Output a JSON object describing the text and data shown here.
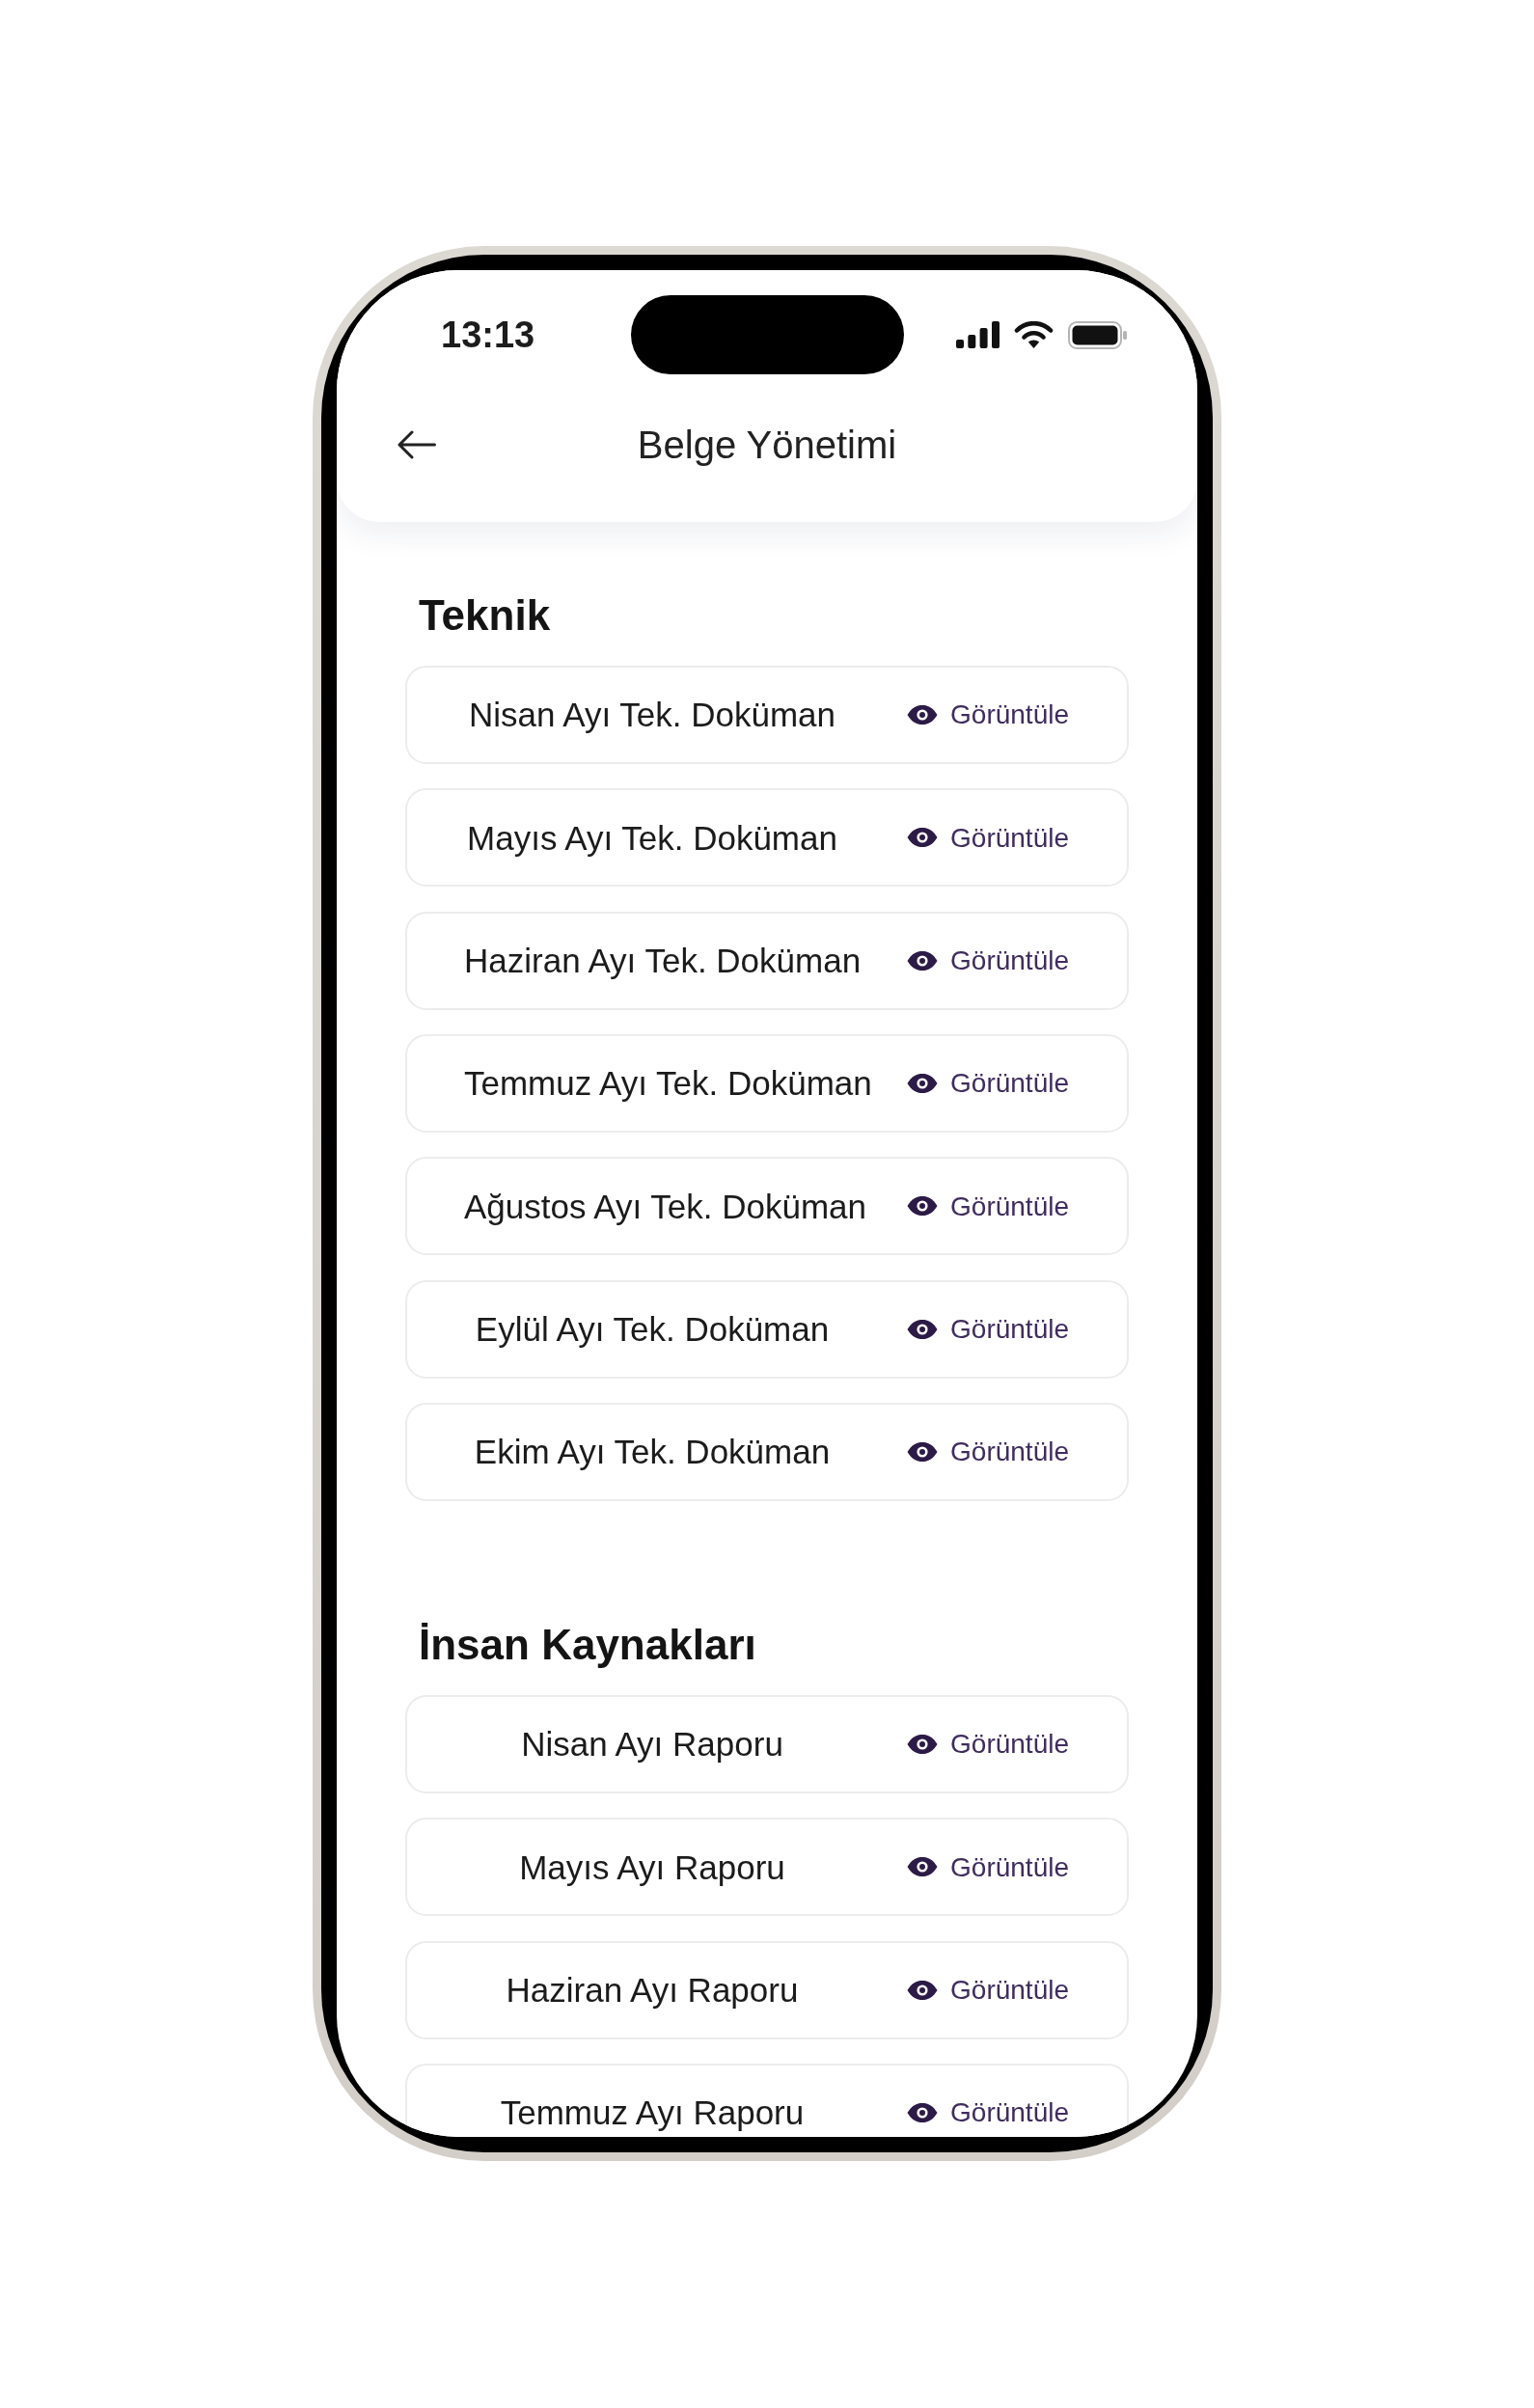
{
  "status_bar": {
    "time": "13:13"
  },
  "header": {
    "title": "Belge Yönetimi"
  },
  "sections": [
    {
      "title": "Teknik",
      "documents": [
        {
          "name": "Nisan Ayı Tek. Doküman",
          "action": "Görüntüle"
        },
        {
          "name": "Mayıs Ayı Tek. Doküman",
          "action": "Görüntüle"
        },
        {
          "name": "Haziran Ayı Tek. Doküman",
          "action": "Görüntüle"
        },
        {
          "name": "Temmuz Ayı Tek. Doküman",
          "action": "Görüntüle"
        },
        {
          "name": "Ağustos Ayı Tek. Doküman",
          "action": "Görüntüle"
        },
        {
          "name": "Eylül Ayı Tek. Doküman",
          "action": "Görüntüle"
        },
        {
          "name": "Ekim Ayı Tek. Doküman",
          "action": "Görüntüle"
        }
      ]
    },
    {
      "title": "İnsan Kaynakları",
      "documents": [
        {
          "name": "Nisan Ayı Raporu",
          "action": "Görüntüle"
        },
        {
          "name": "Mayıs Ayı Raporu",
          "action": "Görüntüle"
        },
        {
          "name": "Haziran Ayı Raporu",
          "action": "Görüntüle"
        },
        {
          "name": "Temmuz Ayı Raporu",
          "action": "Görüntüle"
        }
      ]
    }
  ]
}
